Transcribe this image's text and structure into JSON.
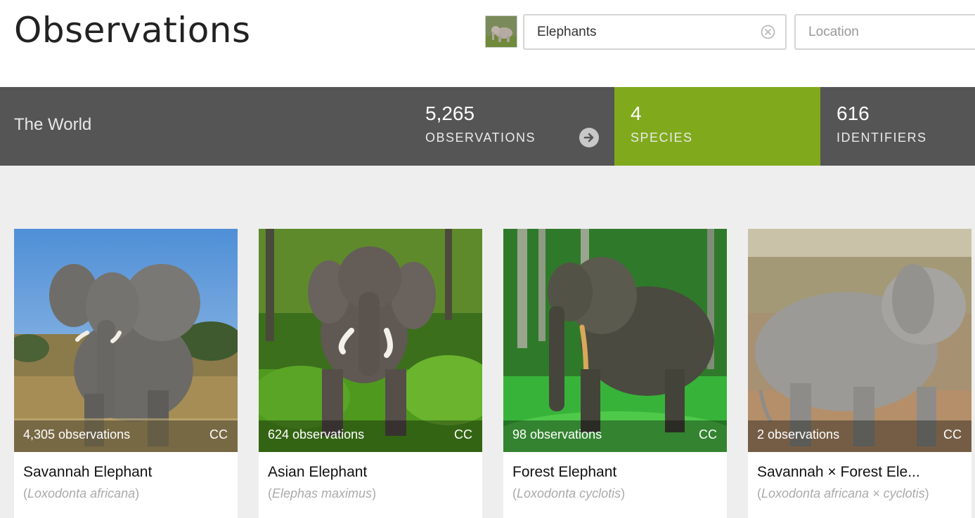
{
  "header": {
    "title": "Observations",
    "search_value": "Elephants",
    "location_placeholder": "Location"
  },
  "stats": {
    "place": "The World",
    "observations": {
      "count": "5,265",
      "label": "OBSERVATIONS"
    },
    "species": {
      "count": "4",
      "label": "SPECIES"
    },
    "identifiers": {
      "count": "616",
      "label": "IDENTIFIERS"
    }
  },
  "colors": {
    "stats_bar": "#555555",
    "active_tab": "#80aa1c",
    "grid_background": "#eeeeee"
  },
  "species": [
    {
      "observations": "4,305 observations",
      "license": "CC",
      "common_name": "Savannah Elephant",
      "scientific_name": "Loxodonta africana"
    },
    {
      "observations": "624 observations",
      "license": "CC",
      "common_name": "Asian Elephant",
      "scientific_name": "Elephas maximus"
    },
    {
      "observations": "98 observations",
      "license": "CC",
      "common_name": "Forest Elephant",
      "scientific_name": "Loxodonta cyclotis"
    },
    {
      "observations": "2 observations",
      "license": "CC",
      "common_name": "Savannah × Forest Ele...",
      "scientific_name": "Loxodonta africana × cyclotis"
    }
  ]
}
